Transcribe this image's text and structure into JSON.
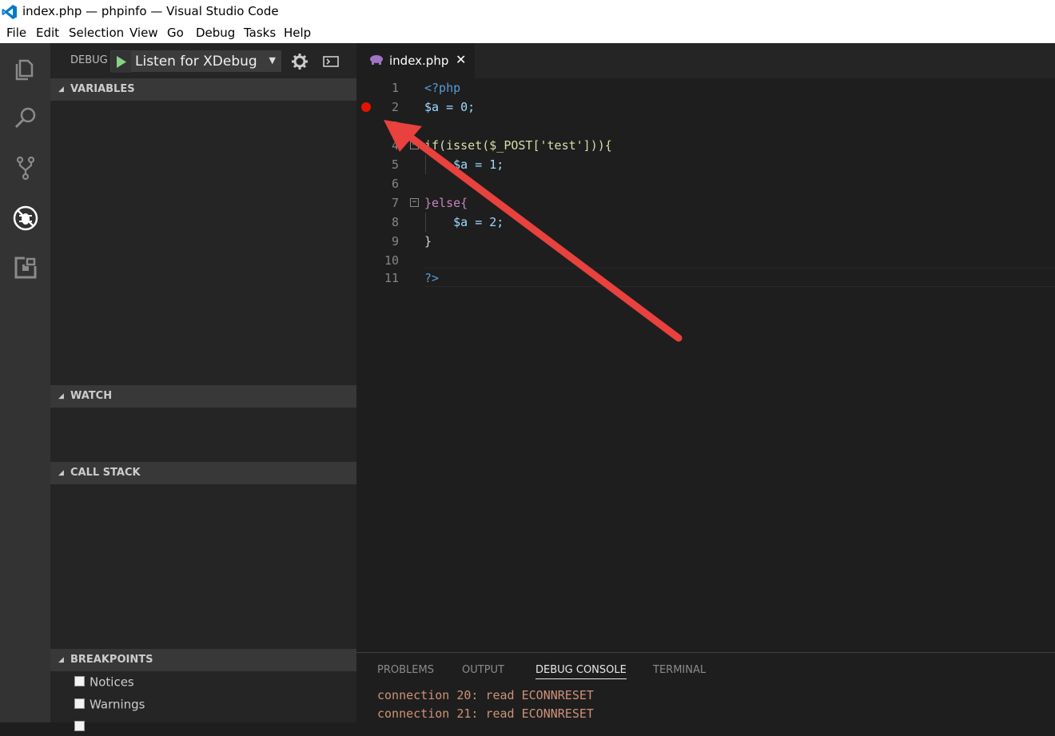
{
  "window": {
    "title": "index.php — phpinfo — Visual Studio Code"
  },
  "menu": [
    "File",
    "Edit",
    "Selection",
    "View",
    "Go",
    "Debug",
    "Tasks",
    "Help"
  ],
  "activity_bar": [
    "explorer-icon",
    "search-icon",
    "source-control-icon",
    "debug-icon",
    "extensions-icon"
  ],
  "debug": {
    "label": "DEBUG",
    "configuration": "Listen for XDebug"
  },
  "sections": {
    "variables": "VARIABLES",
    "watch": "WATCH",
    "call_stack": "CALL STACK",
    "breakpoints": "BREAKPOINTS"
  },
  "breakpoints": [
    {
      "label": "Notices",
      "checked": false
    },
    {
      "label": "Warnings",
      "checked": false
    }
  ],
  "editor": {
    "tab": {
      "label": "index.php",
      "close": "✕"
    },
    "lines": [
      {
        "n": "1",
        "text": "<?php"
      },
      {
        "n": "2",
        "text": "$a = 0;"
      },
      {
        "n": "3",
        "text": ""
      },
      {
        "n": "4",
        "text": "if(isset($_POST['test'])){"
      },
      {
        "n": "5",
        "text": "    $a = 1;"
      },
      {
        "n": "6",
        "text": ""
      },
      {
        "n": "7",
        "text": "}else{"
      },
      {
        "n": "8",
        "text": "    $a = 2;"
      },
      {
        "n": "9",
        "text": "}"
      },
      {
        "n": "10",
        "text": ""
      },
      {
        "n": "11",
        "text": "?>"
      }
    ],
    "breakpoint_line": "2"
  },
  "panel": {
    "tabs": [
      "PROBLEMS",
      "OUTPUT",
      "DEBUG CONSOLE",
      "TERMINAL"
    ],
    "active_tab": "DEBUG CONSOLE",
    "console_lines": [
      "connection 20: read ECONNRESET",
      "connection 21: read ECONNRESET"
    ]
  },
  "colors": {
    "accent": "#007acc",
    "breakpoint": "#e51400",
    "annotation_arrow": "#e8413e"
  }
}
